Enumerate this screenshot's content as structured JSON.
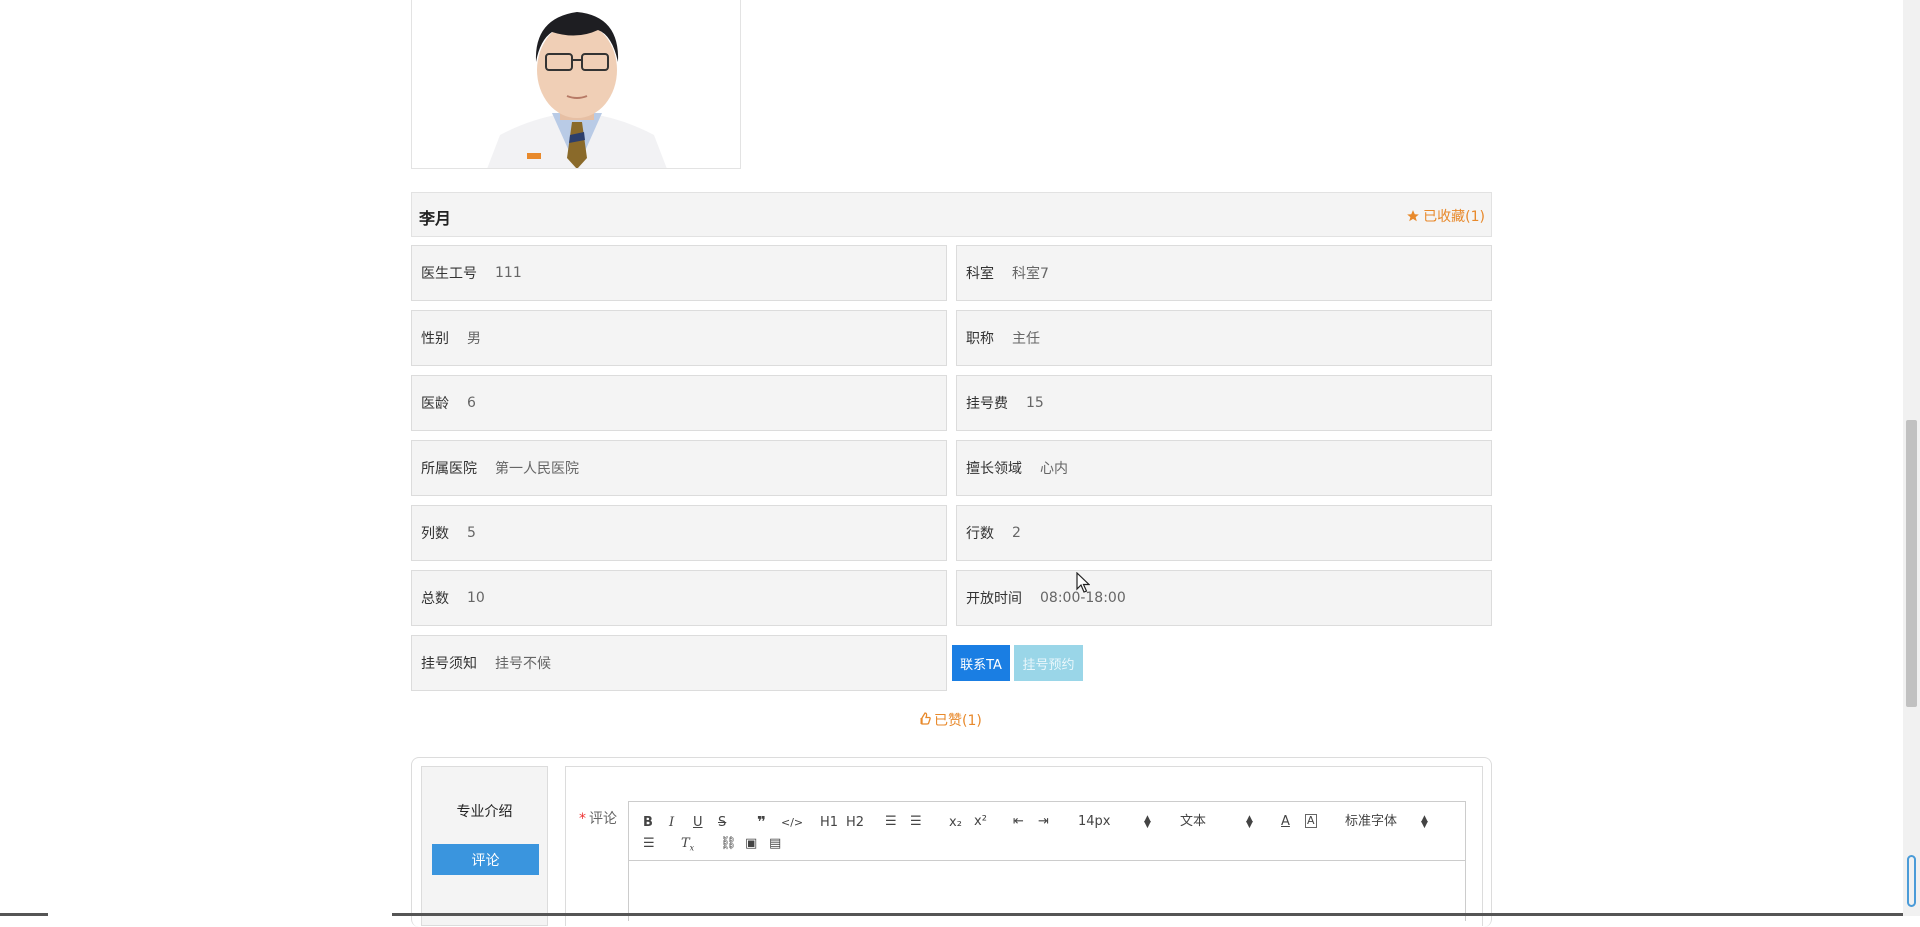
{
  "doctor": {
    "name": "李月",
    "favorite_label": "已收藏(1)"
  },
  "info": {
    "left": [
      {
        "label": "医生工号",
        "value": "111"
      },
      {
        "label": "性别",
        "value": "男"
      },
      {
        "label": "医龄",
        "value": "6"
      },
      {
        "label": "所属医院",
        "value": "第一人民医院"
      },
      {
        "label": "列数",
        "value": "5"
      },
      {
        "label": "总数",
        "value": "10"
      },
      {
        "label": "挂号须知",
        "value": "挂号不候"
      }
    ],
    "right": [
      {
        "label": "科室",
        "value": "科室7"
      },
      {
        "label": "职称",
        "value": "主任"
      },
      {
        "label": "挂号费",
        "value": "15"
      },
      {
        "label": "擅长领域",
        "value": "心内"
      },
      {
        "label": "行数",
        "value": "2"
      },
      {
        "label": "开放时间",
        "value": "08:00-18:00"
      }
    ]
  },
  "actions": {
    "contact_label": "联系TA",
    "book_label": "挂号预约",
    "liked_label": "已赞(1)"
  },
  "tabs": {
    "intro_label": "专业介绍",
    "comment_tab_label": "评论"
  },
  "form": {
    "required_mark": "*",
    "comment_label": "评论"
  },
  "editor": {
    "font_size": "14px",
    "paragraph": "文本",
    "font_family": "标准字体",
    "h1": "H1",
    "h2": "H2",
    "sub": "x₂",
    "sup": "x²"
  },
  "colors": {
    "accent_orange": "#e8892b",
    "primary_blue": "#1a7ee3",
    "disabled_blue": "#9ad6e8",
    "tab_blue": "#3a95de"
  }
}
